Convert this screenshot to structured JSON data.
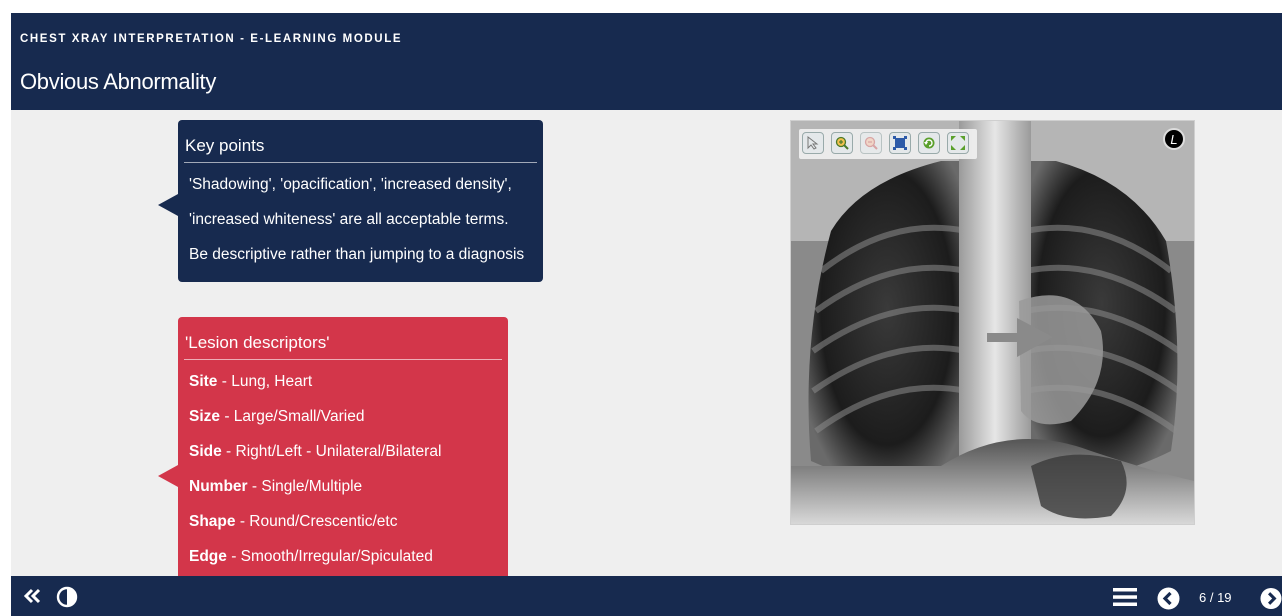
{
  "header": {
    "module_title": "CHEST XRAY INTERPRETATION - E-LEARNING MODULE",
    "page_title": "Obvious Abnormality"
  },
  "key_points": {
    "title": "Key points",
    "lines": [
      "'Shadowing', 'opacification', 'increased density',",
      "'increased whiteness' are all acceptable terms.",
      "Be descriptive rather than jumping to a diagnosis"
    ]
  },
  "lesion": {
    "title": "'Lesion descriptors'",
    "items": [
      {
        "term": "Site",
        "desc": " - Lung, Heart"
      },
      {
        "term": "Size",
        "desc": " - Large/Small/Varied"
      },
      {
        "term": "Side",
        "desc": " - Right/Left - Unilateral/Bilateral"
      },
      {
        "term": "Number",
        "desc": " - Single/Multiple"
      },
      {
        "term": "Shape",
        "desc": " - Round/Crescentic/etc"
      },
      {
        "term": "Edge",
        "desc": " - Smooth/Irregular/Spiculated"
      }
    ]
  },
  "viewer": {
    "orientation_marker": "L",
    "tools": [
      "pointer-icon",
      "zoom-in-icon",
      "zoom-out-icon",
      "fit-icon",
      "reset-icon",
      "fullscreen-icon"
    ]
  },
  "footer": {
    "page_indicator": "6 / 19"
  },
  "colors": {
    "navy": "#172a4f",
    "red": "#d3364a",
    "background": "#efefef"
  }
}
